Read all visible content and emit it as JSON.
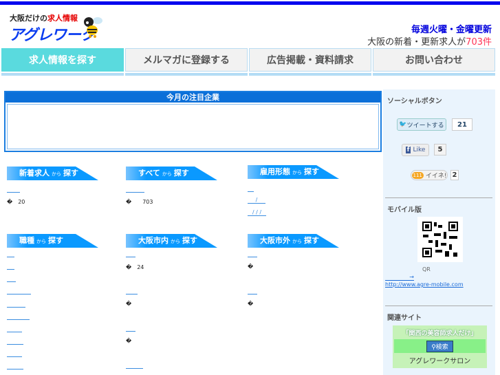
{
  "header": {
    "tagline_a": "大阪だけの",
    "tagline_b": "求人情報",
    "logo": "アグレワーク",
    "update": "毎週火曜・金曜更新",
    "count_prefix": "大阪の新着・更新求人が",
    "count": "703件"
  },
  "nav": [
    "求人情報を探す",
    "メルマガに登録する",
    "広告掲載・資料請求",
    "お問い合わせ"
  ],
  "featured": {
    "title": "今月の注目企業"
  },
  "sections": [
    {
      "title": "新着求人",
      "from": "から",
      "search": "探す",
      "note": "�　20"
    },
    {
      "title": "すべて",
      "from": "から",
      "search": "探す",
      "note": "�　　703"
    },
    {
      "title": "雇用形態",
      "from": "から",
      "search": "探す",
      "links": [
        "",
        "/",
        "/ / /"
      ]
    },
    {
      "title": "職種",
      "from": "から",
      "search": "探す"
    },
    {
      "title": "大阪市内",
      "from": "から",
      "search": "探す",
      "notes": [
        "�　24",
        "�",
        "�"
      ]
    },
    {
      "title": "大阪市外",
      "from": "から",
      "search": "探す",
      "notes": [
        "�",
        "�"
      ]
    }
  ],
  "sidebar": {
    "social_title": "ソーシャルボタン",
    "tweet": "ツイートする",
    "tweet_count": "21",
    "like": "Like",
    "like_count": "5",
    "iine": "イイネ!",
    "iine_count": "2",
    "mobile_title": "モバイル版",
    "qr_label": "QR",
    "arrow": "→",
    "mobile_url": "http://www.agre-mobile.com",
    "related_title": "関連サイト",
    "salon_banner": "「関西の美容師求人だけ」",
    "search_btn": "検索",
    "salon_name": "アグレワークサロン"
  }
}
